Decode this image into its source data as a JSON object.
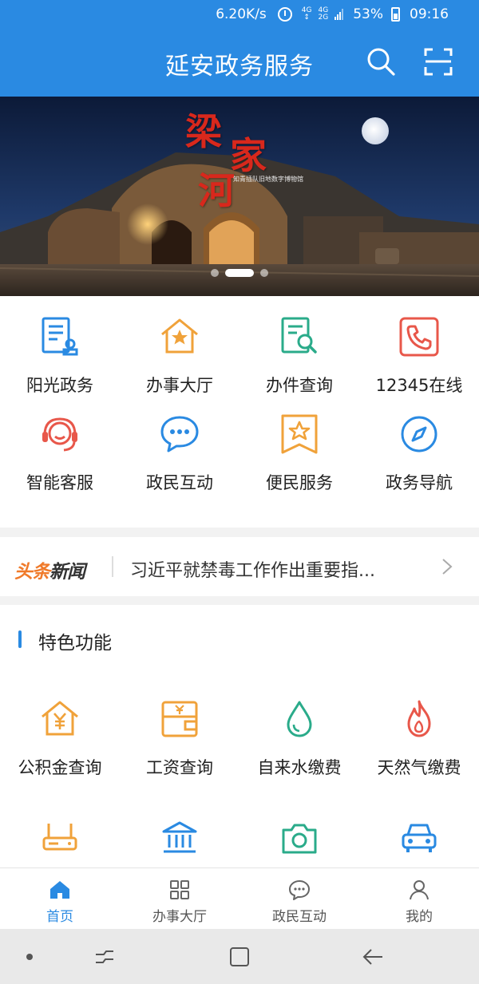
{
  "status": {
    "net_speed": "6.20K/s",
    "sig1": "4G",
    "sig1_sub": "↕",
    "sig2": "4G",
    "sig2_sub": "2G",
    "battery": "53%",
    "time": "09:16"
  },
  "header": {
    "title": "延安政务服务",
    "search_icon": "search-icon",
    "scan_icon": "scan-icon"
  },
  "banner": {
    "title_chars": [
      "梁",
      "家",
      "河"
    ],
    "caption": "知青插队旧地数字博物馆",
    "active_index": 1,
    "dot_count": 3
  },
  "quick_menu": [
    {
      "label": "阳光政务",
      "icon": "document-stamp-icon",
      "color": "#2a8ae2"
    },
    {
      "label": "办事大厅",
      "icon": "house-star-icon",
      "color": "#f0a23a"
    },
    {
      "label": "办件查询",
      "icon": "document-search-icon",
      "color": "#2aab8a"
    },
    {
      "label": "12345在线",
      "icon": "phone-icon",
      "color": "#e8574a"
    },
    {
      "label": "智能客服",
      "icon": "headset-icon",
      "color": "#e8574a"
    },
    {
      "label": "政民互动",
      "icon": "chat-icon",
      "color": "#2a8ae2"
    },
    {
      "label": "便民服务",
      "icon": "star-badge-icon",
      "color": "#f0a23a"
    },
    {
      "label": "政务导航",
      "icon": "compass-icon",
      "color": "#2a8ae2"
    }
  ],
  "news": {
    "logo_part1": "头条",
    "logo_part2": "新闻",
    "headline": "习近平就禁毒工作作出重要指..."
  },
  "features": {
    "title": "特色功能",
    "items": [
      {
        "label": "公积金查询",
        "icon": "house-yuan-icon",
        "color": "#f0a23a"
      },
      {
        "label": "工资查询",
        "icon": "wallet-yuan-icon",
        "color": "#f0a23a"
      },
      {
        "label": "自来水缴费",
        "icon": "water-drop-icon",
        "color": "#2aab8a"
      },
      {
        "label": "天然气缴费",
        "icon": "flame-icon",
        "color": "#e8574a"
      },
      {
        "label": "",
        "icon": "router-icon",
        "color": "#f0a23a"
      },
      {
        "label": "",
        "icon": "bank-icon",
        "color": "#2a8ae2"
      },
      {
        "label": "",
        "icon": "camera-icon",
        "color": "#2aab8a"
      },
      {
        "label": "",
        "icon": "car-icon",
        "color": "#2a8ae2"
      }
    ]
  },
  "bottom_nav": [
    {
      "label": "首页",
      "icon": "home-icon",
      "active": true
    },
    {
      "label": "办事大厅",
      "icon": "grid-icon",
      "active": false
    },
    {
      "label": "政民互动",
      "icon": "chat-bubble-icon",
      "active": false
    },
    {
      "label": "我的",
      "icon": "user-icon",
      "active": false
    }
  ],
  "colors": {
    "primary": "#2a8ae2",
    "orange": "#f0a23a",
    "green": "#2aab8a",
    "red": "#e8574a"
  }
}
